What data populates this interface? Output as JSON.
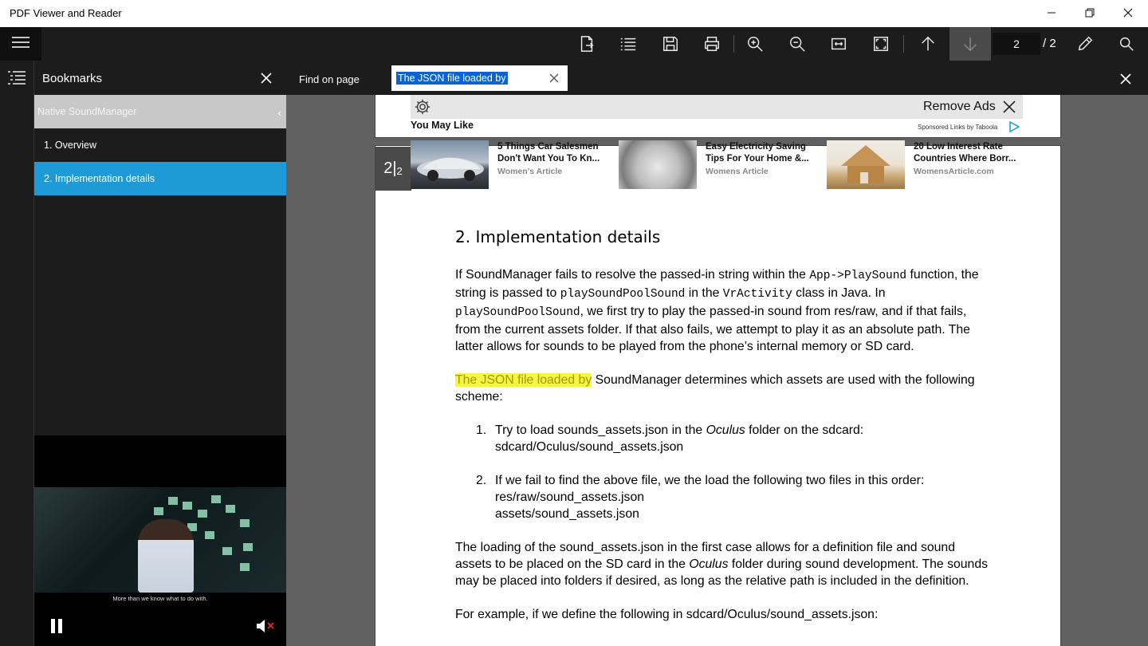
{
  "window": {
    "title": "PDF Viewer and Reader",
    "minimize_icon": "minimize-icon",
    "restore_icon": "restore-icon",
    "close_icon": "close-icon"
  },
  "toolbar": {
    "current_page": "2",
    "total_pages": "/ 2",
    "icons": [
      "menu-icon",
      "export-icon",
      "list-icon",
      "save-icon",
      "print-icon",
      "zoom-in-icon",
      "zoom-out-icon",
      "fit-width-icon",
      "fit-page-icon",
      "arrow-up-icon",
      "arrow-down-icon",
      "pen-icon",
      "search-icon"
    ]
  },
  "bookmarks": {
    "title": "Bookmarks",
    "items": [
      {
        "label": "Native SoundManager"
      },
      {
        "label": "1. Overview"
      },
      {
        "label": "2. Implementation details"
      }
    ],
    "video_subtitle": "More than we know what to do with."
  },
  "find": {
    "label": "Find on page",
    "query": "The JSON file loaded by"
  },
  "page_indicator": {
    "current": "2",
    "total": "2"
  },
  "ad": {
    "remove_label": "Remove Ads",
    "heading": "You May Like",
    "sponsored": "Sponsored Links by Taboola",
    "cards": [
      {
        "headline": "5 Things Car Salesmen Don't Want You To Kn...",
        "source": "Women's Article"
      },
      {
        "headline": "Easy Electricity Saving Tips For Your Home &...",
        "source": "Womens Article"
      },
      {
        "headline": "20 Low Interest Rate Countries Where Borr...",
        "source": "WomensArticle.com"
      }
    ]
  },
  "pdf": {
    "heading": "2. Implementation details",
    "p1_a": "If SoundManager fails to resolve the passed-in string within the ",
    "p1_code1": "App->PlaySound",
    "p1_b": " function, the string is passed to ",
    "p1_code2": "playSoundPoolSound",
    "p1_c": " in the ",
    "p1_code3": "VrActivity",
    "p1_d": " class in Java. In ",
    "p1_code4": "playSoundPoolSound",
    "p1_e": ", we first try to play the passed-in sound from res/raw, and if that fails, from the current assets folder. If that also fails, we attempt to play it as an absolute path. The latter allows for sounds to be played from the phone’s internal memory or SD card.",
    "p2_highlight": "The JSON file loaded by",
    "p2_rest": " SoundManager determines which assets are used with the following scheme:",
    "li1_num": "1.",
    "li1_a": "Try to load sounds_assets.json in the ",
    "li1_em": "Oculus",
    "li1_b": " folder on the sdcard:",
    "li1_path": "sdcard/Oculus/sound_assets.json",
    "li2_num": "2.",
    "li2_a": "If we fail to find the above file, we the load the following two files in this order:",
    "li2_path1": "res/raw/sound_assets.json",
    "li2_path2": "assets/sound_assets.json",
    "p3_a": "The loading of the sound_assets.json in the first case allows for a definition file and sound assets to be placed on the SD card in the ",
    "p3_em": "Oculus",
    "p3_b": " folder during sound development. The sounds may be placed into folders if desired, as long as the relative path is included in the definition.",
    "p4": "For example, if we define the following in sdcard/Oculus/sound_assets.json:"
  }
}
